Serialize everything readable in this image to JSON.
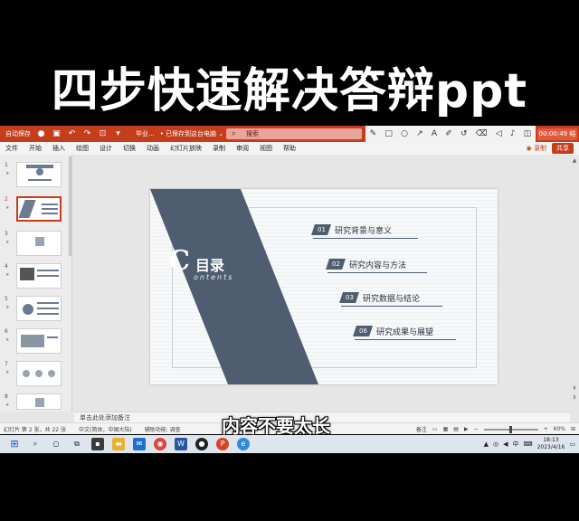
{
  "headline": "四步快速解决答辩ppt",
  "titlebar": {
    "autosave": "自动保存",
    "autosave_toggle": "●",
    "filename": "毕业...",
    "saved_status": "• 已保存到这台电脑 ⌄",
    "search_placeholder": "搜索"
  },
  "recorder": {
    "time": "00:00:49 结束"
  },
  "ribbon": {
    "tabs": [
      "文件",
      "开始",
      "插入",
      "绘图",
      "设计",
      "切换",
      "动画",
      "幻灯片放映",
      "录制",
      "审阅",
      "视图",
      "帮助"
    ],
    "record_label": "◉ 录制",
    "share_label": "共享"
  },
  "thumbnails": [
    {
      "num": "1",
      "star": "★"
    },
    {
      "num": "2",
      "star": "★"
    },
    {
      "num": "3",
      "star": "★"
    },
    {
      "num": "4",
      "star": "★"
    },
    {
      "num": "5",
      "star": "★"
    },
    {
      "num": "6",
      "star": "★"
    },
    {
      "num": "7",
      "star": "★"
    },
    {
      "num": "8",
      "star": "★"
    }
  ],
  "slide": {
    "title": "目录",
    "title_initial": "C",
    "subtitle": "ontents",
    "items": [
      {
        "num": "01",
        "label": "研究背景与意义"
      },
      {
        "num": "02",
        "label": "研究内容与方法"
      },
      {
        "num": "03",
        "label": "研究数据与结论"
      },
      {
        "num": "06",
        "label": "研究成果与展望"
      }
    ],
    "band_color": "#4f5d70"
  },
  "notes_placeholder": "单击此处添加备注",
  "statusbar": {
    "slide_info": "幻灯片 第 2 张，共 22 张",
    "language": "中文(简体，中国大陆)",
    "accessibility": "辅助功能: 调查",
    "notes_btn": "备注",
    "zoom": "60%"
  },
  "subtitle_overlay": "内容不要太长",
  "taskbar": {
    "ime": "中",
    "time": "18:13",
    "date": "2023/4/16"
  },
  "colors": {
    "ppt_accent": "#c43e1c"
  }
}
